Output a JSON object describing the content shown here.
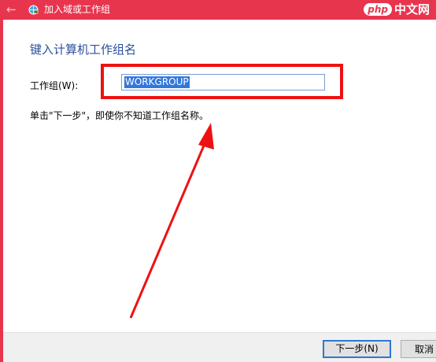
{
  "window": {
    "title": "加入域或工作组",
    "back_icon": "back-arrow-icon",
    "title_icon": "network-icon",
    "background_color": "#e8354e"
  },
  "watermark": {
    "logo": "php",
    "text": "中文网"
  },
  "main": {
    "heading": "键入计算机工作组名",
    "workgroup_label": "工作组(W):",
    "workgroup_value": "WORKGROUP",
    "hint": "单击\"下一步\"，即使你不知道工作组名称。"
  },
  "annotations": {
    "highlight_color": "#ee1111"
  },
  "footer": {
    "next_label": "下一步(N)",
    "cancel_label": "取消"
  }
}
